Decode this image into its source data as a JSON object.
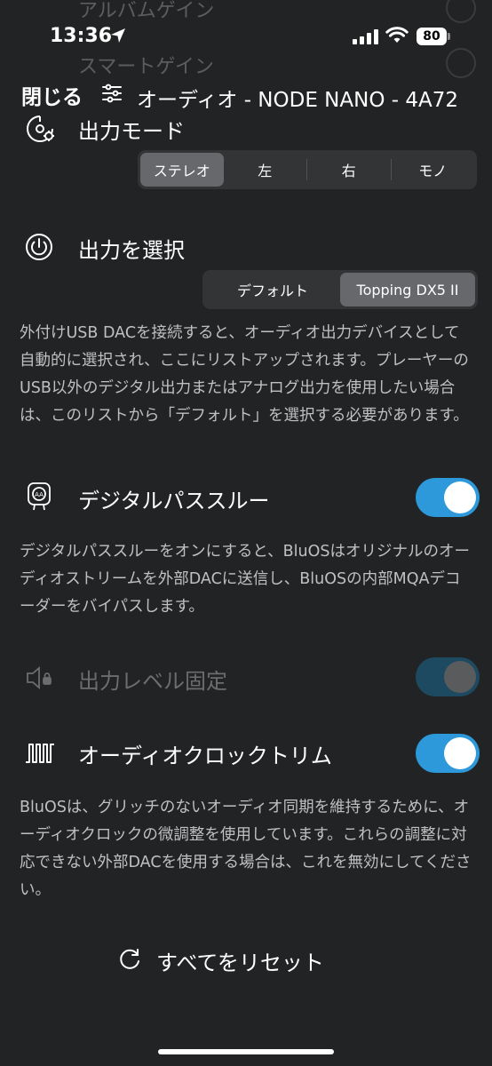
{
  "status_bar": {
    "time": "13:36",
    "battery": "80"
  },
  "background_rows": [
    "アルバムゲイン",
    "スマートゲイン"
  ],
  "header": {
    "close_label": "閉じる",
    "title": "オーディオ - NODE NANO - 4A72"
  },
  "output_mode": {
    "label": "出力モード",
    "options": [
      "ステレオ",
      "左",
      "右",
      "モノ"
    ],
    "selected": "ステレオ"
  },
  "output_select": {
    "label": "出力を選択",
    "options": [
      "デフォルト",
      "Topping DX5 II"
    ],
    "selected": "Topping DX5 II",
    "description": "外付けUSB DACを接続すると、オーディオ出力デバイスとして自動的に選択され、ここにリストアップされます。プレーヤーのUSB以外のデジタル出力またはアナログ出力を使用したい場合は、このリストから「デフォルト」を選択する必要があります。"
  },
  "digital_passthrough": {
    "label": "デジタルパススルー",
    "enabled": true,
    "description": "デジタルパススルーをオンにすると、BluOSはオリジナルのオーディオストリームを外部DACに送信し、BluOSの内部MQAデコーダーをバイパスします。"
  },
  "fixed_volume": {
    "label": "出力レベル固定",
    "enabled": true,
    "disabled": true
  },
  "clock_trim": {
    "label": "オーディオクロックトリム",
    "enabled": true,
    "description": "BluOSは、グリッチのないオーディオ同期を維持するために、オーディオクロックの微調整を使用しています。これらの調整に対応できない外部DACを使用する場合は、これを無効にしてください。"
  },
  "reset": {
    "label": "すべてをリセット"
  },
  "colors": {
    "background": "#222324",
    "toggle_on": "#2d98da",
    "toggle_disabled": "#1e4a61"
  }
}
